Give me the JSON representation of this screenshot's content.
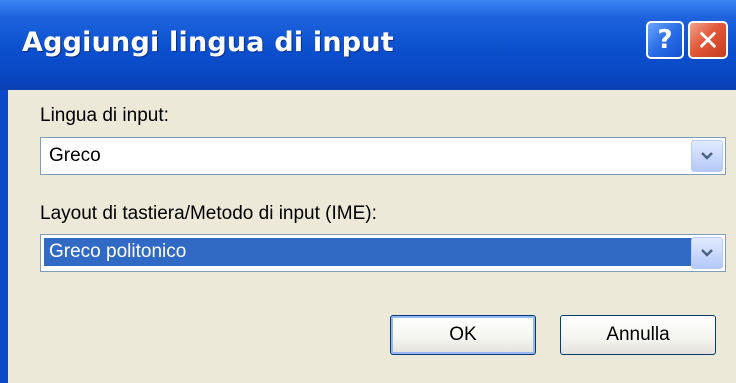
{
  "window": {
    "title": "Aggiungi lingua di input",
    "help_icon": "question-mark-icon",
    "close_icon": "close-x-icon"
  },
  "dialog": {
    "input_language_label": "Lingua di input:",
    "input_language_value": "Greco",
    "layout_label": "Layout di tastiera/Metodo di input (IME):",
    "layout_value": "Greco politonico",
    "ok_label": "OK",
    "cancel_label": "Annulla"
  },
  "colors": {
    "titlebar": "#0b4fcf",
    "dialog_background": "#ece9d8",
    "selection": "#316ac5",
    "close_button": "#e2583a"
  }
}
